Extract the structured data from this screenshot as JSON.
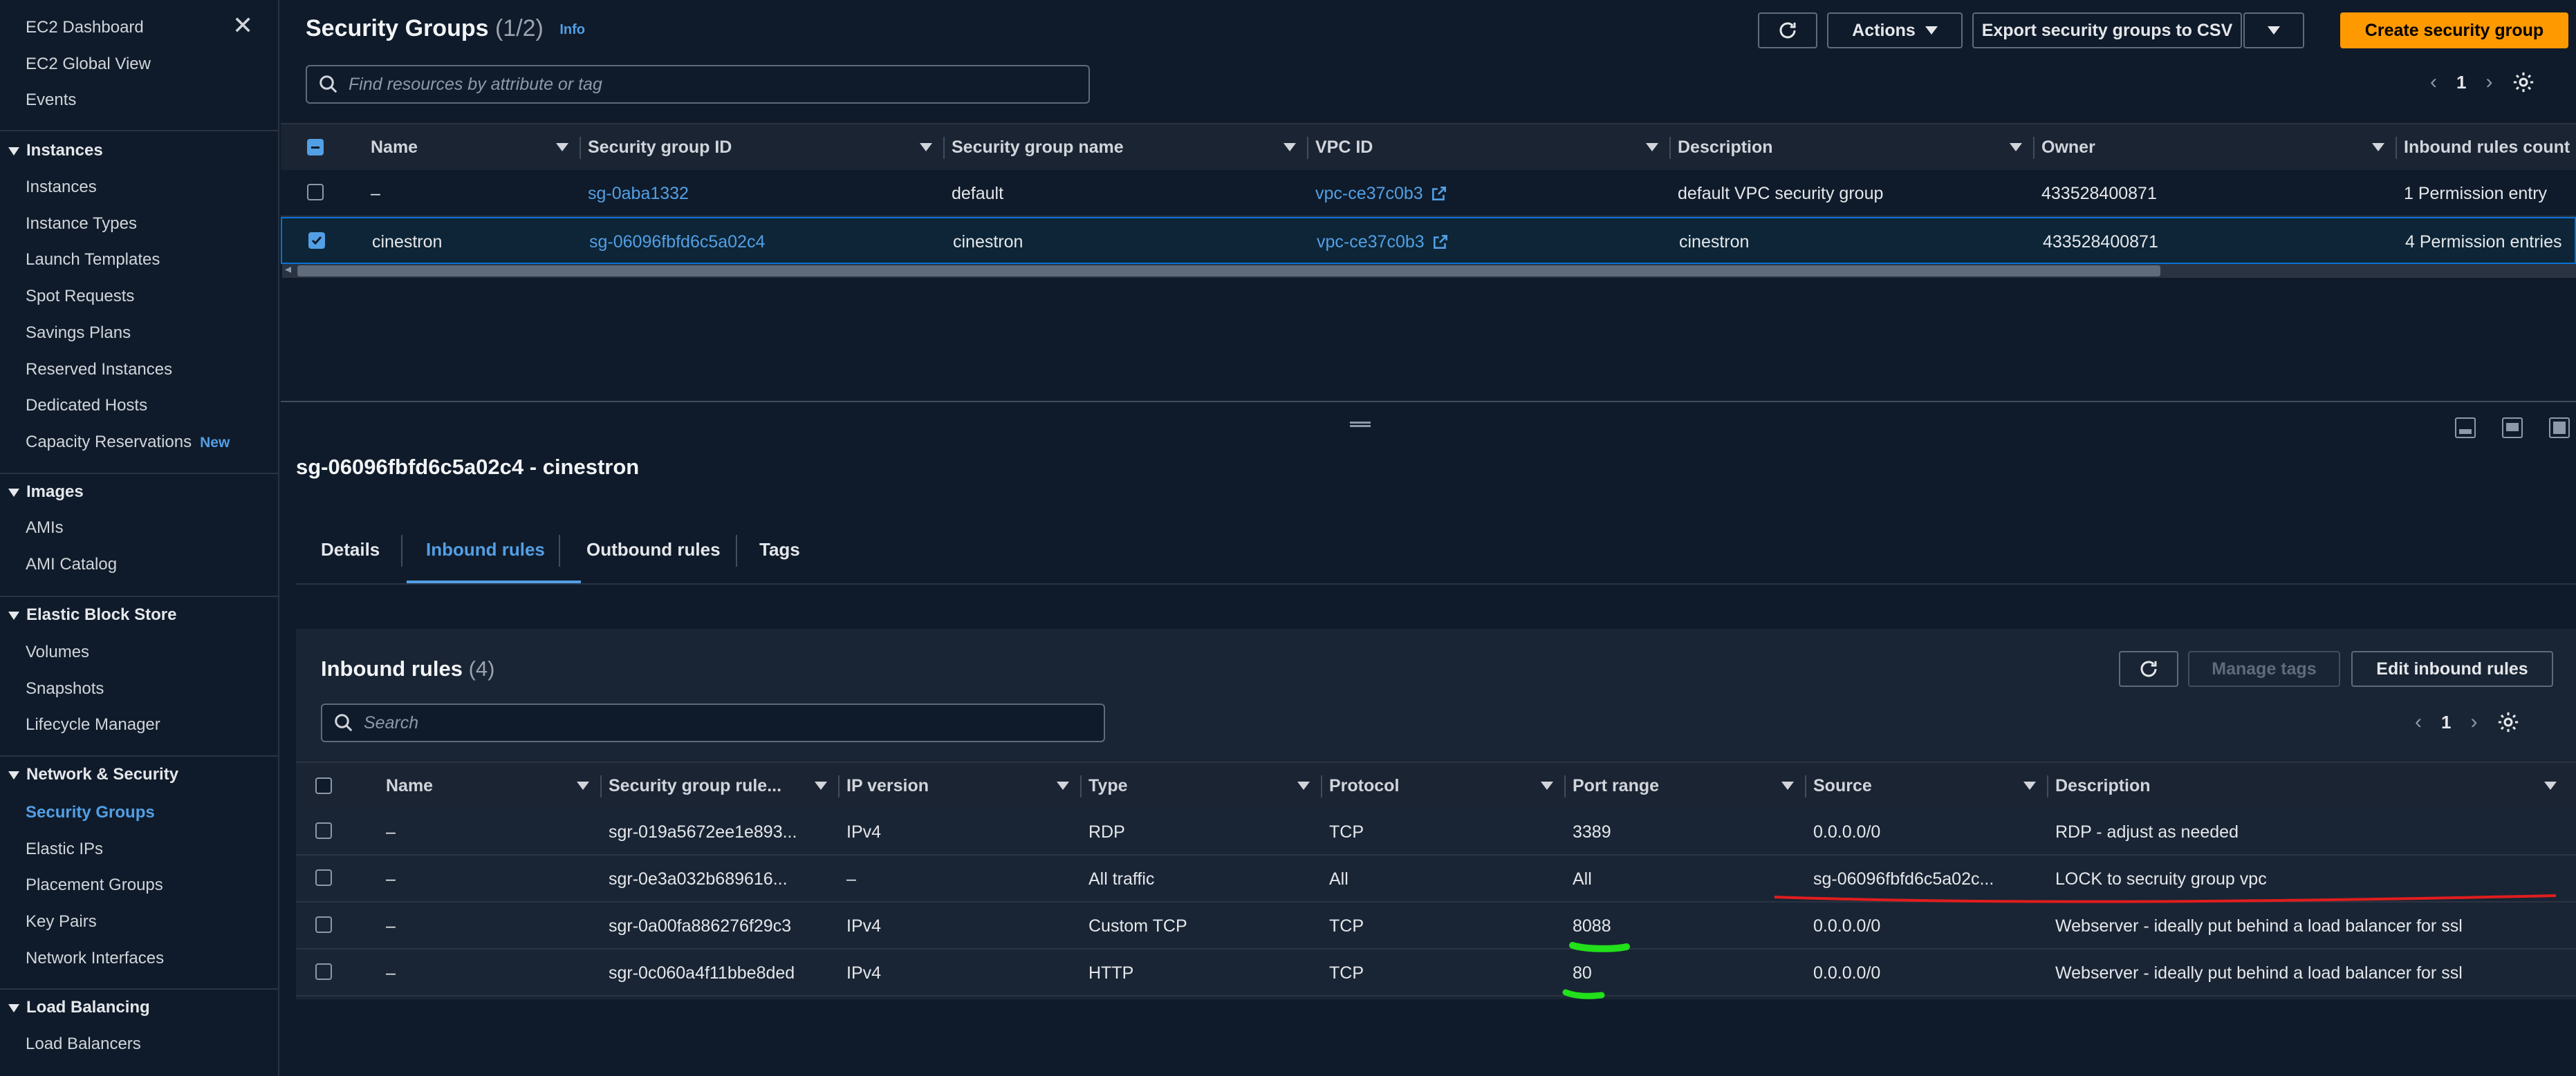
{
  "sidebar": {
    "top_items": [
      "EC2 Dashboard",
      "EC2 Global View",
      "Events"
    ],
    "sections": [
      {
        "title": "Instances",
        "items": [
          "Instances",
          "Instance Types",
          "Launch Templates",
          "Spot Requests",
          "Savings Plans",
          "Reserved Instances",
          "Dedicated Hosts",
          "Capacity Reservations"
        ]
      },
      {
        "title": "Images",
        "items": [
          "AMIs",
          "AMI Catalog"
        ]
      },
      {
        "title": "Elastic Block Store",
        "items": [
          "Volumes",
          "Snapshots",
          "Lifecycle Manager"
        ]
      },
      {
        "title": "Network & Security",
        "items": [
          "Security Groups",
          "Elastic IPs",
          "Placement Groups",
          "Key Pairs",
          "Network Interfaces"
        ]
      },
      {
        "title": "Load Balancing",
        "items": [
          "Load Balancers"
        ]
      }
    ],
    "new_badge": "New",
    "active_item": "Security Groups"
  },
  "header": {
    "title": "Security Groups",
    "count": "(1/2)",
    "info": "Info",
    "actions_label": "Actions",
    "export_label": "Export security groups to CSV",
    "create_label": "Create security group",
    "search_placeholder": "Find resources by attribute or tag",
    "page": "1"
  },
  "sg_table": {
    "columns": [
      "Name",
      "Security group ID",
      "Security group name",
      "VPC ID",
      "Description",
      "Owner",
      "Inbound rules count"
    ],
    "rows": [
      {
        "name": "–",
        "id": "sg-0aba1332",
        "group_name": "default",
        "vpc": "vpc-ce37c0b3",
        "description": "default VPC security group",
        "owner": "433528400871",
        "inbound": "1 Permission entry",
        "selected": false
      },
      {
        "name": "cinestron",
        "id": "sg-06096fbfd6c5a02c4",
        "group_name": "cinestron",
        "vpc": "vpc-ce37c0b3",
        "description": "cinestron",
        "owner": "433528400871",
        "inbound": "4 Permission entries",
        "selected": true
      }
    ]
  },
  "detail": {
    "title": "sg-06096fbfd6c5a02c4 - cinestron",
    "tabs": [
      "Details",
      "Inbound rules",
      "Outbound rules",
      "Tags"
    ],
    "active_tab": "Inbound rules"
  },
  "inbound": {
    "title": "Inbound rules",
    "count": "(4)",
    "manage_tags_label": "Manage tags",
    "edit_label": "Edit inbound rules",
    "search_placeholder": "Search",
    "page": "1",
    "columns": [
      "Name",
      "Security group rule...",
      "IP version",
      "Type",
      "Protocol",
      "Port range",
      "Source",
      "Description"
    ],
    "rows": [
      {
        "name": "–",
        "rule_id": "sgr-019a5672ee1e893...",
        "ip_version": "IPv4",
        "type": "RDP",
        "protocol": "TCP",
        "port": "3389",
        "source": "0.0.0.0/0",
        "description": "RDP - adjust as needed"
      },
      {
        "name": "–",
        "rule_id": "sgr-0e3a032b689616...",
        "ip_version": "–",
        "type": "All traffic",
        "protocol": "All",
        "port": "All",
        "source": "sg-06096fbfd6c5a02c...",
        "description": "LOCK to secruity group vpc"
      },
      {
        "name": "–",
        "rule_id": "sgr-0a00fa886276f29c3",
        "ip_version": "IPv4",
        "type": "Custom TCP",
        "protocol": "TCP",
        "port": "8088",
        "source": "0.0.0.0/0",
        "description": "Webserver - ideally put behind a load balancer for ssl"
      },
      {
        "name": "–",
        "rule_id": "sgr-0c060a4f11bbe8ded",
        "ip_version": "IPv4",
        "type": "HTTP",
        "protocol": "TCP",
        "port": "80",
        "source": "0.0.0.0/0",
        "description": "Webserver - ideally put behind a load balancer for ssl"
      }
    ]
  },
  "colors": {
    "accent": "#539fe5",
    "primary_button": "#ff9900",
    "annotation_red": "#e11d1d",
    "annotation_green": "#22e01a"
  }
}
